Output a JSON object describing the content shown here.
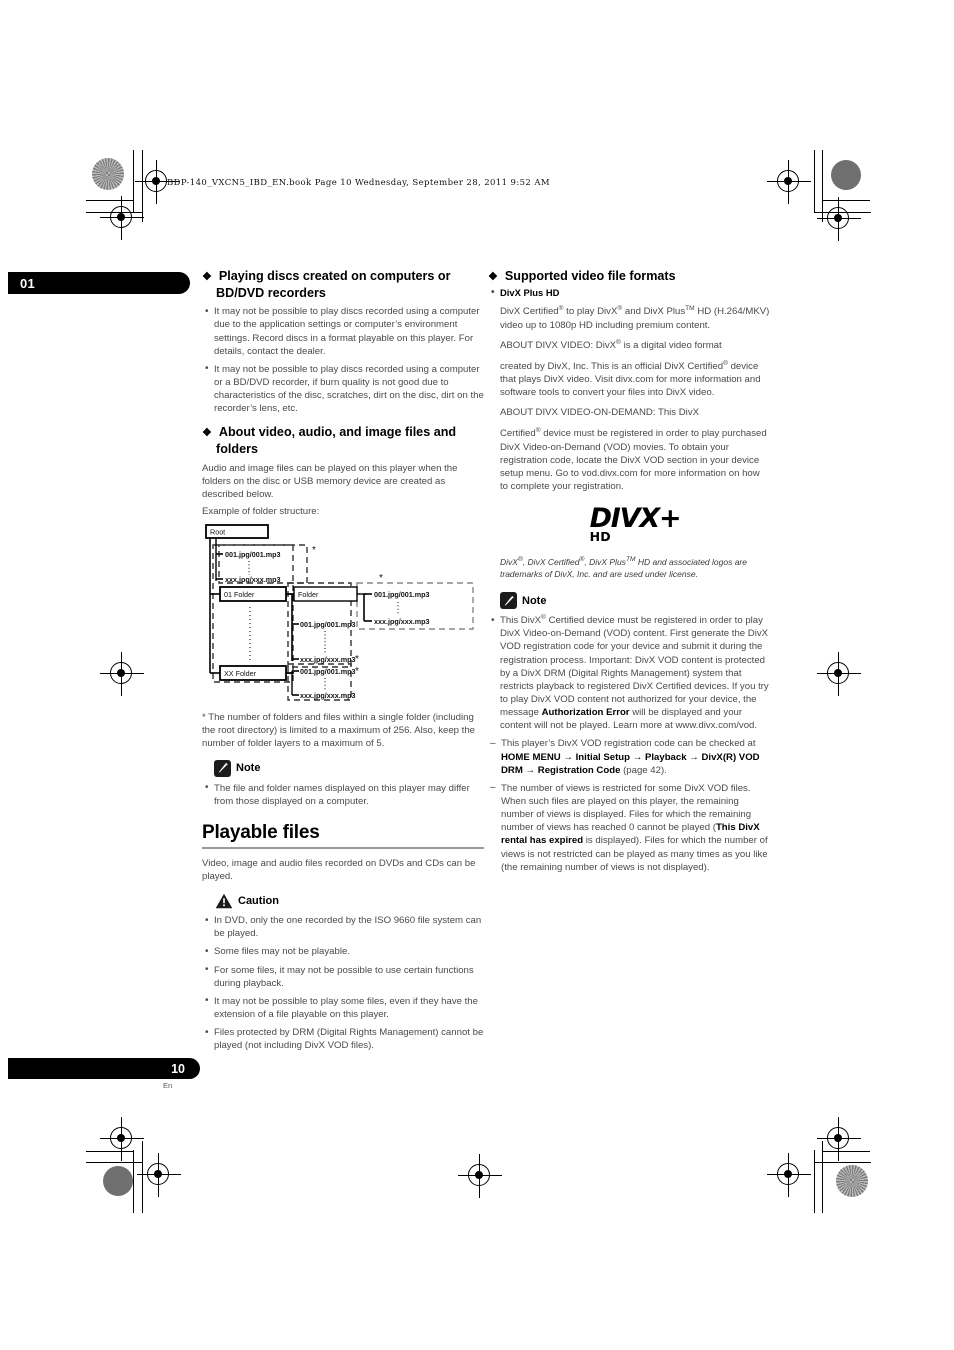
{
  "print_slug": "BDP-140_VXCN5_IBD_EN.book   Page 10   Wednesday, September 28, 2011   9:52 AM",
  "chapter_tab": "01",
  "page_footer": {
    "number": "10",
    "language": "En"
  },
  "left_column": {
    "section1": {
      "heading": "Playing discs created on computers or BD/DVD recorders",
      "bullets": [
        "It may not be possible to play discs recorded using a computer due to the application settings or computer’s environment settings. Record discs in a format playable on this player. For details, contact the dealer.",
        "It may not be possible to play discs recorded using a computer or a BD/DVD recorder, if burn quality is not good due to characteristics of the disc, scratches, dirt on the disc, dirt on the recorder’s lens, etc."
      ]
    },
    "section2": {
      "heading": "About video, audio, and image files and folders",
      "intro": "Audio and image files can be played on this player when the folders on the disc or USB memory device are created as described below.",
      "example_label": "Example of folder structure:",
      "diagram": {
        "root_label": "Root",
        "folder_01_label": "01 Folder",
        "folder_xx_label": "XX Folder",
        "folder_label": "Folder",
        "file_first": "001.jpg/001.mp3",
        "file_last": "xxx.jpg/xxx.mp3",
        "star": "*"
      },
      "footnote": "* The number of folders and files within a single folder (including the root directory) is limited to a maximum of 256. Also, keep the number of folder layers to a maximum of 5.",
      "note_label": "Note",
      "note_bullets": [
        "The file and folder names displayed on this player may differ from those displayed on a computer."
      ]
    },
    "section3": {
      "heading": "Playable files",
      "intro": "Video, image and audio files recorded on DVDs and CDs can be played.",
      "caution_label": "Caution",
      "caution_bullets": [
        "In DVD, only the one recorded by the ISO 9660 file system can be played.",
        "Some files may not be playable.",
        "For some files, it may not be possible to use certain functions during playback.",
        "It may not be possible to play some files, even if they have the extension of a file playable on this player.",
        "Files protected by DRM (Digital Rights Management) cannot be played (not including DivX VOD files)."
      ]
    }
  },
  "right_column": {
    "heading": "Supported video file formats",
    "subheading": "DivX Plus HD",
    "paragraphs": {
      "p1_a": "DivX Certified",
      "p1_b": " to play DivX",
      "p1_c": " and DivX Plus",
      "p1_tm": "TM",
      "p1_d": " HD (H.264/MKV) video up to 1080p HD including premium content.",
      "p2_a": "ABOUT DIVX VIDEO: DivX",
      "p2_b": " is a digital video format",
      "p3_a": "created by DivX, Inc. This is an official DivX Certified",
      "p3_b": " device that plays DivX video. Visit divx.com for more information and software tools to convert your files into DivX video.",
      "p4_a": "ABOUT DIVX VIDEO-ON-DEMAND: This DivX",
      "p5_a": "Certified",
      "p5_b": " device must be registered in order to play purchased DivX Video-on-Demand (VOD) movies. To obtain your registration code, locate the DivX VOD section in your device setup menu. Go to vod.divx.com for more information on how to complete your registration."
    },
    "logo": {
      "word": "DIVX",
      "plus": "+",
      "hd": "HD"
    },
    "trademark": {
      "t1": "DivX",
      "t2": ", DivX Certified",
      "t3": ", DivX Plus",
      "tm": "TM",
      "t4": " HD and associated logos are trademarks of DivX, Inc. and are used under license."
    },
    "note_label": "Note",
    "note_bullet_1": {
      "a": "This DivX",
      "b": " Certified device must be registered in order to play DivX Video-on-Demand (VOD) content. First generate the DivX VOD registration code for your device and submit it during the registration process. Important: DivX VOD content is protected by a DivX DRM (Digital Rights Management) system that restricts playback to registered DivX Certified devices. If you try to play DivX VOD content not authorized for your device, the message ",
      "bold": "Authorization Error",
      "c": " will be displayed and your content will not be played. Learn more at www.divx.com/vod."
    },
    "note_bullet_2": {
      "a": "This player’s DivX VOD registration code can be checked at ",
      "path1": "HOME MENU",
      "arrow": "→",
      "path2": "Initial Setup",
      "path3": "Playback",
      "path4": "DivX(R) VOD DRM",
      "path5": "Registration Code",
      "b": " (page 42)."
    },
    "note_bullet_3": {
      "a": "The number of views is restricted for some DivX VOD files. When such files are played on this player, the remaining number of views is displayed. Files for which the remaining number of views has reached 0 cannot be played (",
      "bold": "This DivX rental has expired",
      "b": " is displayed). Files for which the number of views is not restricted can be played as many times as you like (the remaining number of views is not displayed)."
    }
  }
}
